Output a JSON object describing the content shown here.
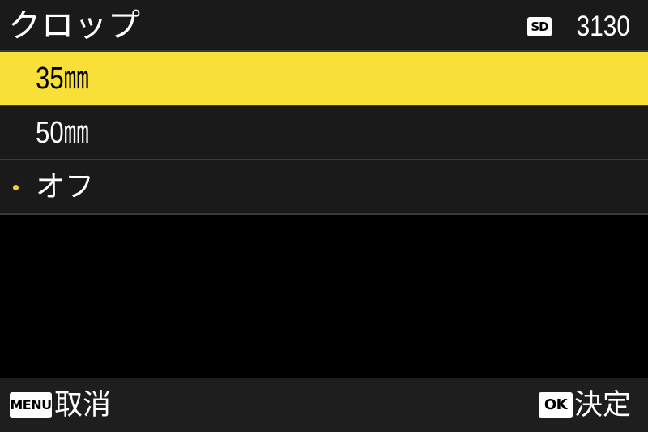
{
  "header": {
    "title": "クロップ",
    "storage_badge": "SD",
    "remaining_shots": "3130"
  },
  "menu": {
    "items": [
      {
        "label": "35㎜",
        "selected": true,
        "current": false
      },
      {
        "label": "50㎜",
        "selected": false,
        "current": false
      },
      {
        "label": "オフ",
        "selected": false,
        "current": true
      }
    ]
  },
  "footer": {
    "menu_key": "MENU",
    "cancel_label": "取消",
    "ok_key": "OK",
    "confirm_label": "決定"
  },
  "colors": {
    "highlight": "#f8e038",
    "current_marker": "#f8c838",
    "row_background": "#1a1a1a",
    "screen_background": "#000000"
  }
}
